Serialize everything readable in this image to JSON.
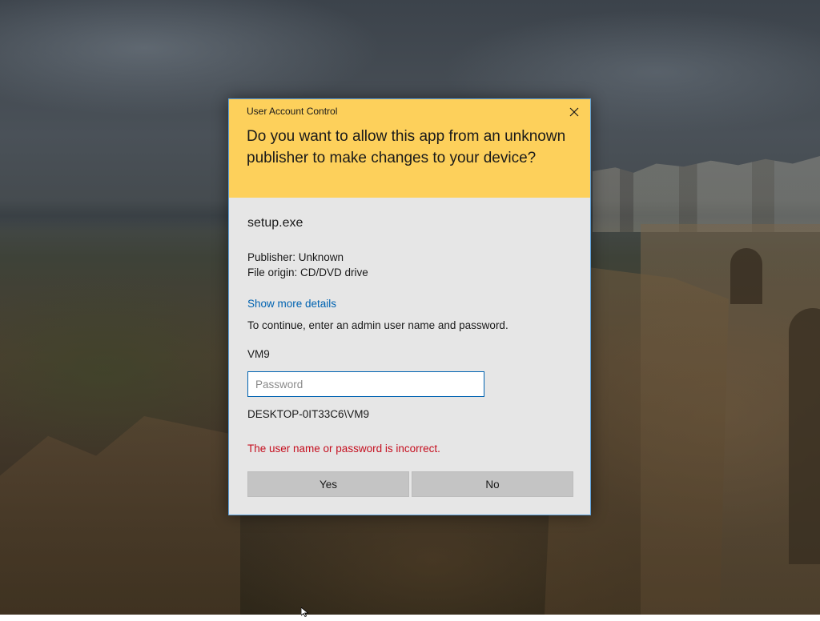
{
  "dialog": {
    "caption": "User Account Control",
    "question": "Do you want to allow this app from an unknown publisher to make changes to your device?",
    "app_name": "setup.exe",
    "publisher": "Publisher: Unknown",
    "file_origin": "File origin: CD/DVD drive",
    "details_link": "Show more details",
    "instruction": "To continue, enter an admin user name and password.",
    "username": "VM9",
    "password": {
      "value": "",
      "placeholder": "Password"
    },
    "domain_user": "DESKTOP-0IT33C6\\VM9",
    "error_message": "The user name or password is incorrect.",
    "buttons": {
      "yes": "Yes",
      "no": "No"
    }
  },
  "icons": {
    "close": "close-icon",
    "cursor": "mouse-pointer-icon"
  },
  "colors": {
    "header": "#fdd05b",
    "dialog_body": "#e6e6e6",
    "dialog_border": "#5ea0d9",
    "link": "#0063b1",
    "error": "#c50f1f",
    "input_border": "#0063b1",
    "button_fill": "#c4c4c4"
  }
}
